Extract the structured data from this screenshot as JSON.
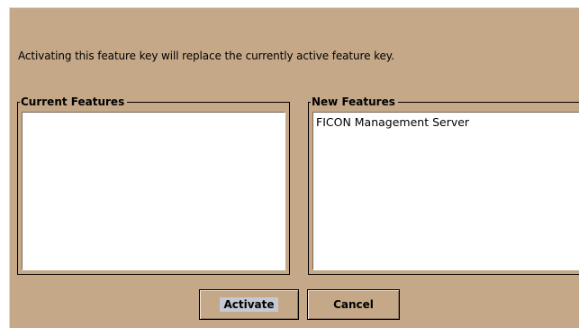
{
  "dialog": {
    "message": "Activating this feature key will replace the currently active feature key."
  },
  "current_features": {
    "title": "Current Features",
    "items": []
  },
  "new_features": {
    "title": "New Features",
    "items": [
      "FICON Management Server"
    ]
  },
  "buttons": {
    "activate_label": "Activate",
    "cancel_label": "Cancel"
  },
  "colors": {
    "dialog_background": "#c4a888",
    "list_background": "#ffffff",
    "focus_highlight": "#c6c8d2"
  }
}
